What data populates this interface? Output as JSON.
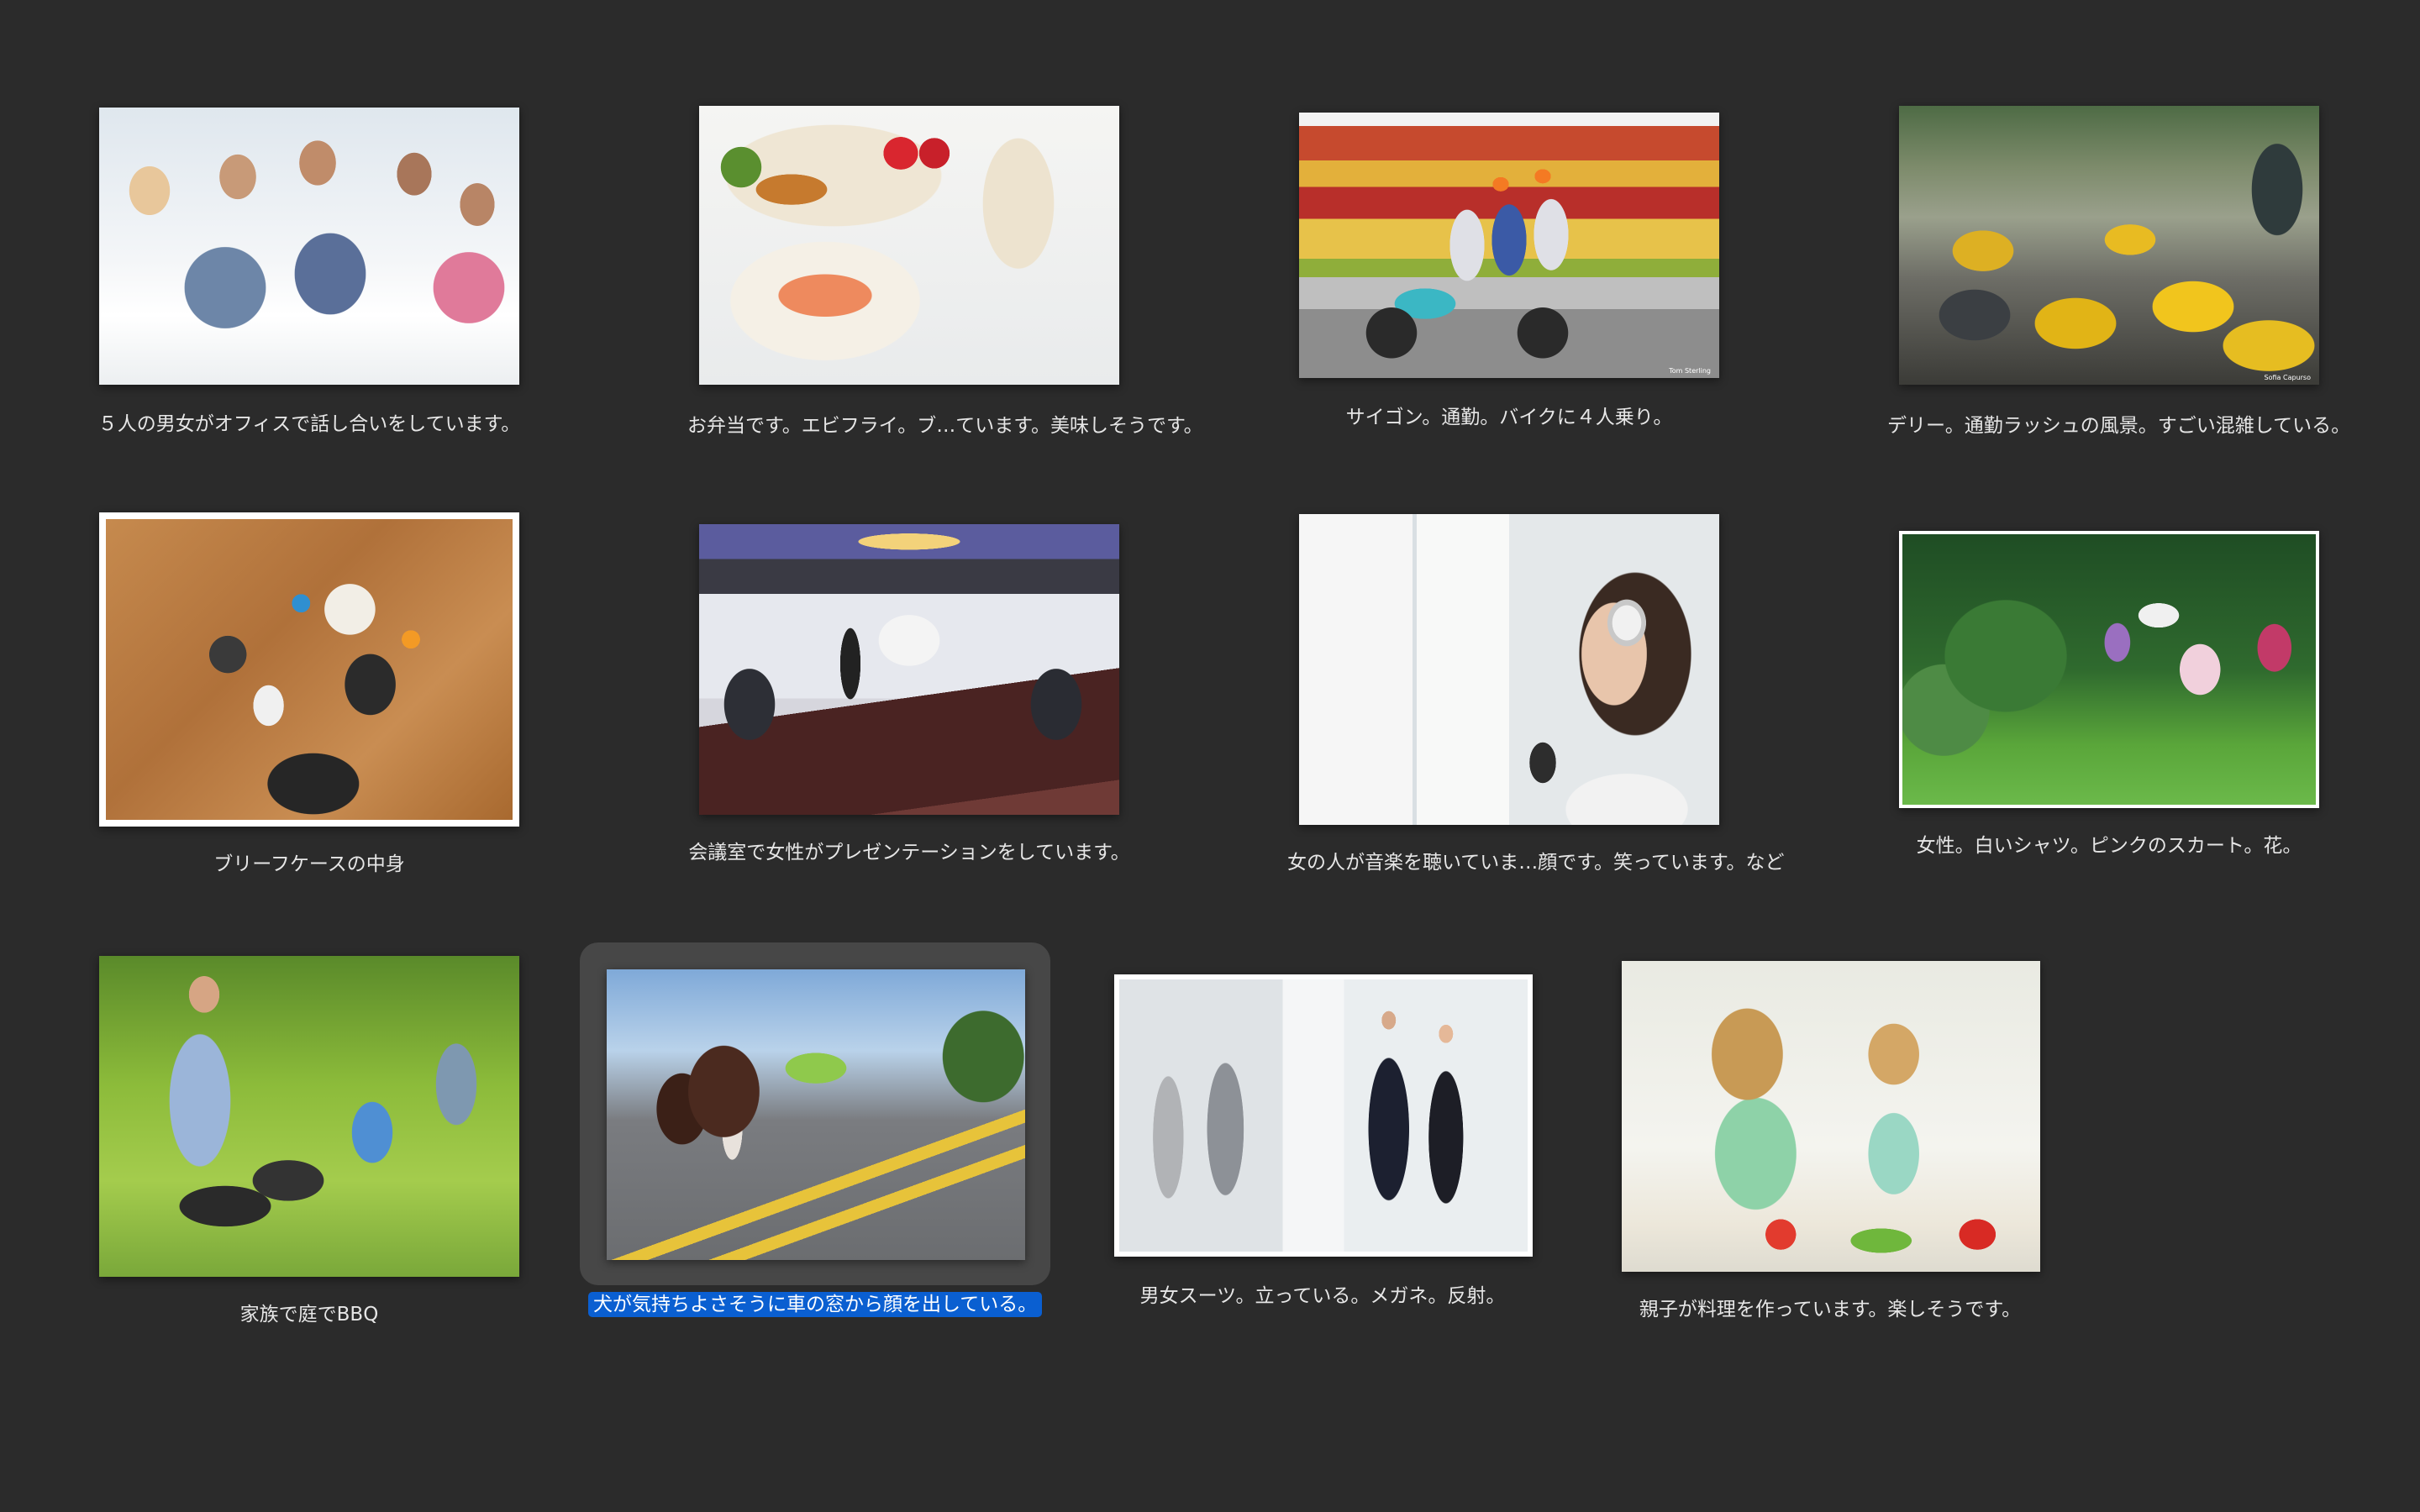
{
  "gallery": {
    "items": [
      {
        "caption": "５人の男女がオフィスで話し合いをしています。",
        "selected": false
      },
      {
        "caption": "お弁当です。エビフライ。ブ…ています。美味しそうです。",
        "selected": false
      },
      {
        "caption": "サイゴン。通勤。バイクに４人乗り。",
        "selected": false
      },
      {
        "caption": "デリー。通勤ラッシュの風景。すごい混雑している。",
        "selected": false
      },
      {
        "caption": "ブリーフケースの中身",
        "selected": false
      },
      {
        "caption": "会議室で女性がプレゼンテーションをしています。",
        "selected": false
      },
      {
        "caption": "女の人が音楽を聴いていま…顔です。笑っています。など",
        "selected": false
      },
      {
        "caption": "女性。白いシャツ。ピンクのスカート。花。",
        "selected": false
      },
      {
        "caption": "家族で庭でBBQ",
        "selected": false
      },
      {
        "caption": "犬が気持ちよさそうに車の窓から顔を出している。",
        "selected": true
      },
      {
        "caption": "男女スーツ。立っている。メガネ。反射。",
        "selected": false
      },
      {
        "caption": "親子が料理を作っています。楽しそうです。",
        "selected": false
      }
    ],
    "photo_credits": {
      "saigon": "Tom Sterling",
      "delhi": "Sofia Capurso"
    }
  },
  "colors": {
    "background": "#2b2b2b",
    "selection_tile": "#474747",
    "selection_caption": "#0a5fd1",
    "caption_text": "#e6e6e6"
  }
}
